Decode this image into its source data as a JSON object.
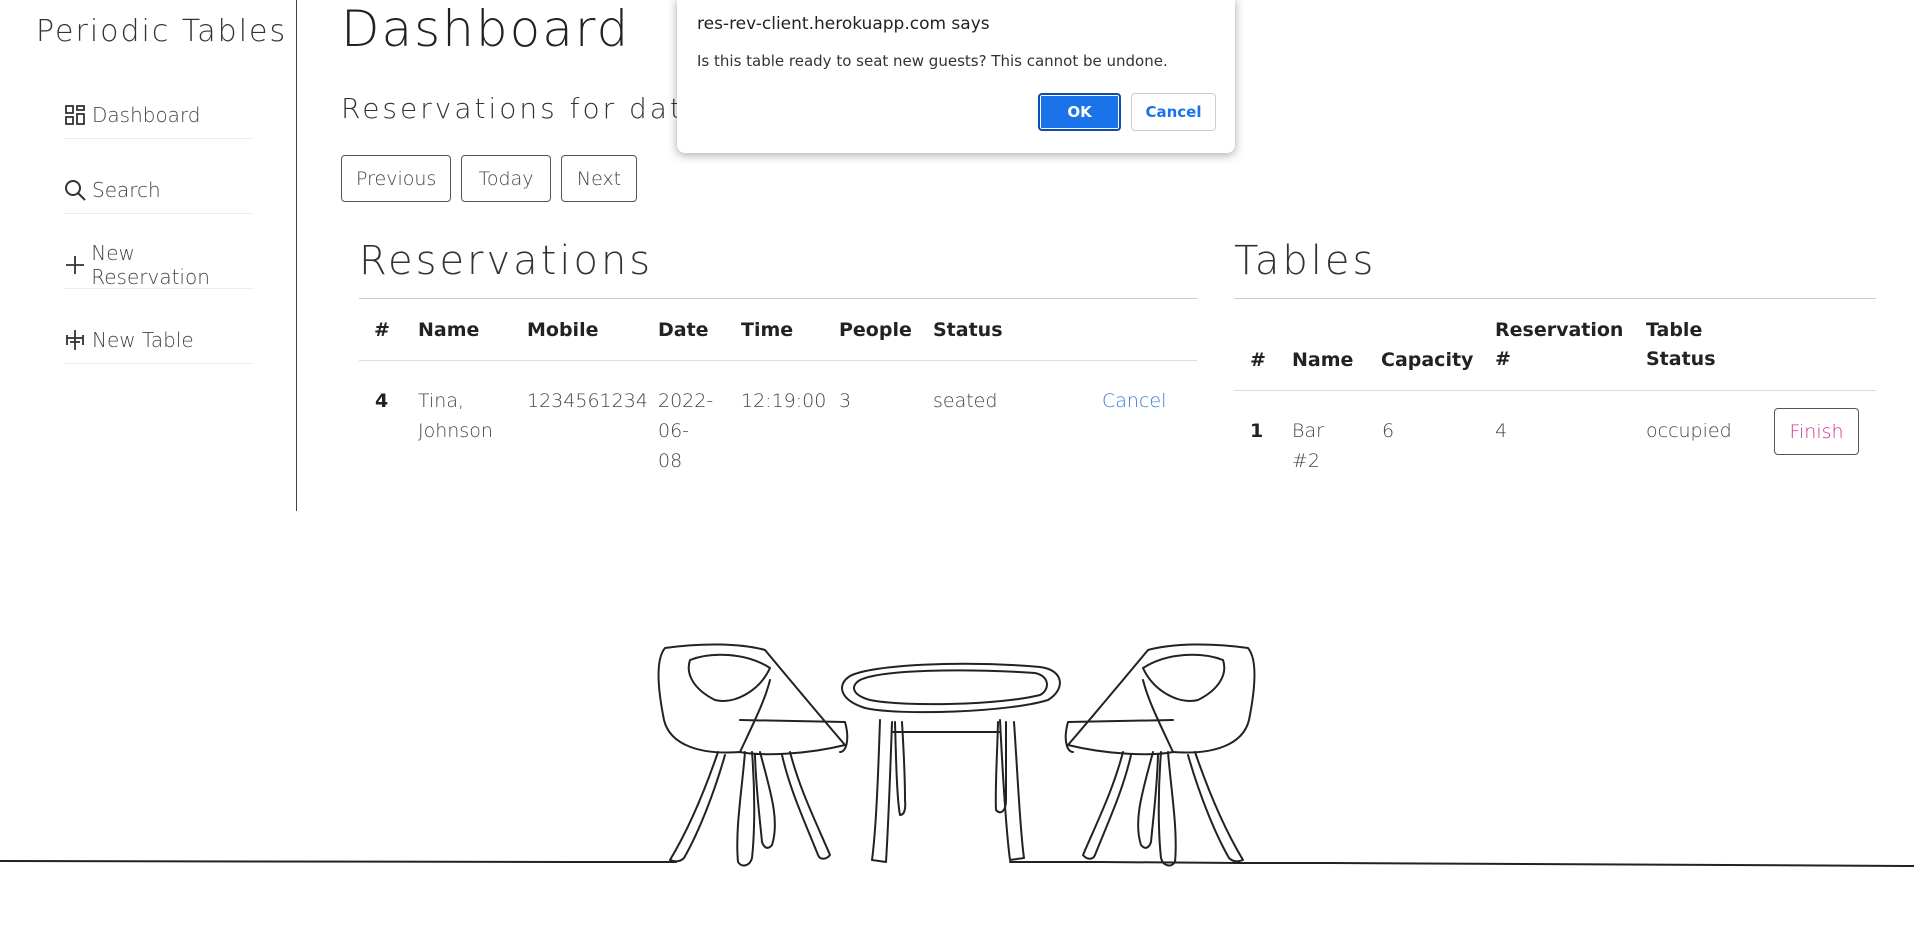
{
  "app": {
    "brand": "Periodic Tables"
  },
  "sidebar": {
    "items": [
      {
        "label": "Dashboard",
        "icon": "dashboard-icon"
      },
      {
        "label": "Search",
        "icon": "search-icon"
      },
      {
        "label": "New Reservation",
        "icon": "plus-icon"
      },
      {
        "label": "New Table",
        "icon": "table-icon"
      }
    ]
  },
  "main": {
    "title": "Dashboard",
    "date_heading": "Reservations for date",
    "buttons": {
      "previous": "Previous",
      "today": "Today",
      "next": "Next"
    }
  },
  "reservations": {
    "title": "Reservations",
    "columns": [
      "#",
      "Name",
      "Mobile",
      "Date",
      "Time",
      "People",
      "Status"
    ],
    "rows": [
      {
        "id": "4",
        "name_first": "Tina,",
        "name_last": "Johnson",
        "mobile": "1234561234",
        "date_1": "2022-",
        "date_2": "06-",
        "date_3": "08",
        "time": "12:19:00",
        "people": "3",
        "status": "seated",
        "action": "Cancel"
      }
    ]
  },
  "tables": {
    "title": "Tables",
    "columns": {
      "id": "#",
      "name": "Name",
      "capacity": "Capacity",
      "res_1": "Reservation",
      "res_2": "#",
      "status_1": "Table",
      "status_2": "Status"
    },
    "rows": [
      {
        "id": "1",
        "name_1": "Bar",
        "name_2": "#2",
        "capacity": "6",
        "reservation": "4",
        "status": "occupied",
        "action": "Finish"
      }
    ]
  },
  "dialog": {
    "title": "res-rev-client.herokuapp.com says",
    "message": "Is this table ready to seat new guests? This cannot be undone.",
    "ok": "OK",
    "cancel": "Cancel"
  },
  "colors": {
    "link": "#3a7bd5",
    "finish": "#d6338a",
    "dialog_ok": "#1a73e8"
  }
}
